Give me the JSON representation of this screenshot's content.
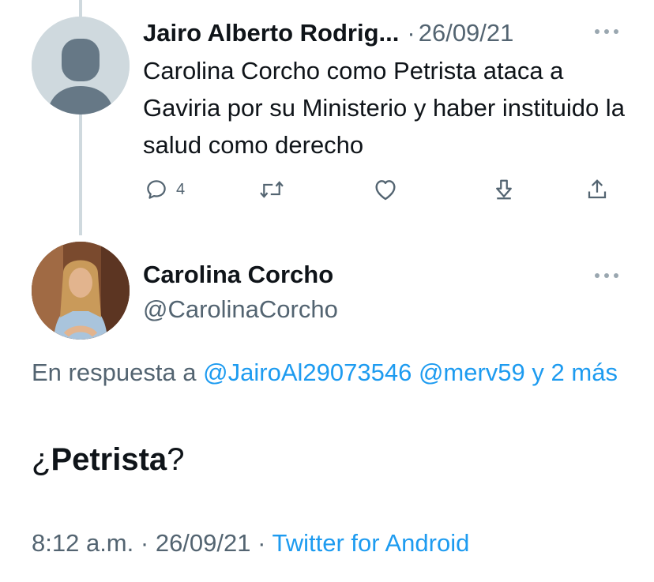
{
  "parent_tweet": {
    "author_name": "Jairo Alberto Rodrig...",
    "separator": "·",
    "date": "26/09/21",
    "text": "Carolina Corcho como Petrista ataca a Gaviria por su Ministerio y haber instituido la salud como derecho",
    "actions": {
      "reply_count": "4"
    }
  },
  "main_tweet": {
    "author_name": "Carolina Corcho",
    "handle": "@CarolinaCorcho",
    "reply_prefix": "En respuesta a",
    "reply_mention_1": "@JairoAl29073546",
    "reply_mention_2": "@merv59",
    "reply_suffix_a": "y",
    "reply_suffix_b": "2 más",
    "text_prefix": "¿",
    "text_bold": "Petrista",
    "text_suffix": "?",
    "time": "8:12 a.m.",
    "meta_sep_1": "·",
    "date": "26/09/21",
    "meta_sep_2": "·",
    "source": "Twitter for Android"
  },
  "colors": {
    "accent": "#1d9bf0",
    "secondary_text": "#536471",
    "primary_text": "#0f1419",
    "thread_line": "#cfd9de"
  }
}
